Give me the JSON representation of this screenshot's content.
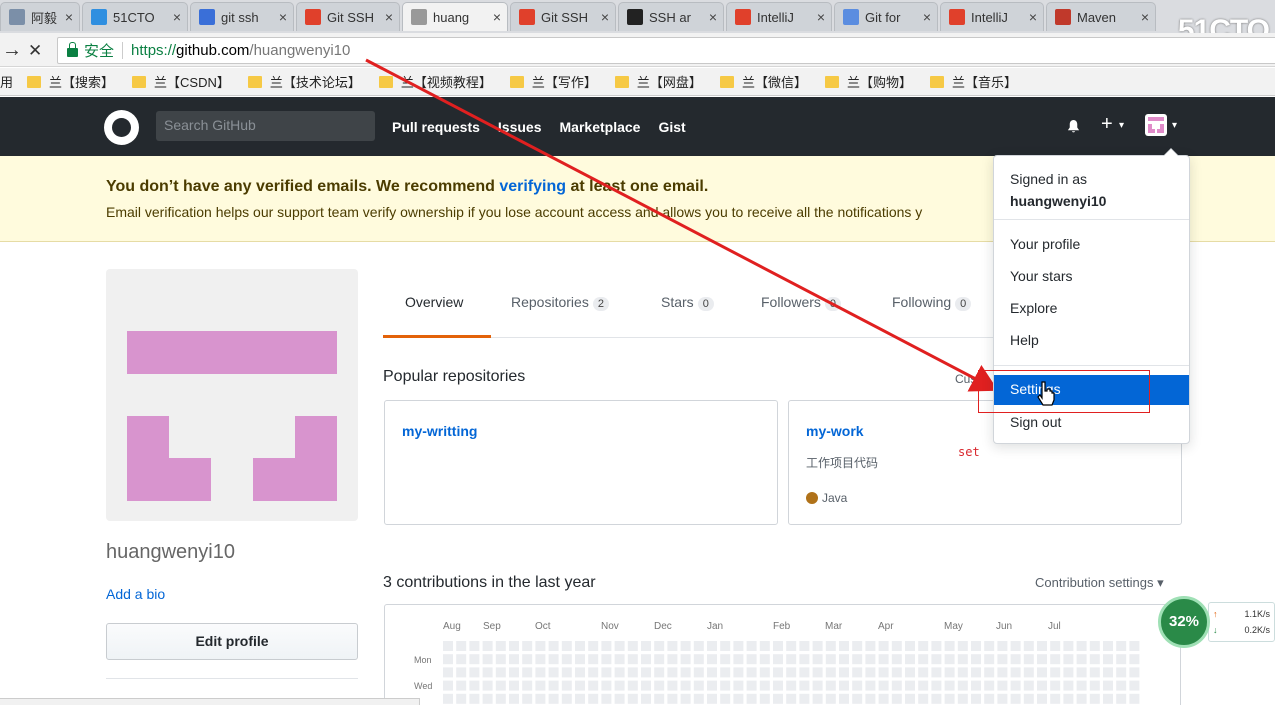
{
  "browser": {
    "tabs": [
      {
        "label": "阿毅 - ",
        "color": "#7b8fa8"
      },
      {
        "label": "51CTO",
        "color": "#2f8fe0"
      },
      {
        "label": "git ssh",
        "color": "#3a6fd8"
      },
      {
        "label": "Git SSH",
        "color": "#e0402b"
      },
      {
        "label": "huang",
        "color": "#999999"
      },
      {
        "label": "Git SSH",
        "color": "#e0402b"
      },
      {
        "label": "SSH ar",
        "color": "#222222"
      },
      {
        "label": "IntelliJ",
        "color": "#e0402b"
      },
      {
        "label": "Git for",
        "color": "#5b8de0"
      },
      {
        "label": "IntelliJ",
        "color": "#e0402b"
      },
      {
        "label": "Maven",
        "color": "#c0392b"
      }
    ],
    "close_glyph": "×",
    "watermark": "51CTO",
    "back_glyph": "→",
    "stop_glyph": "✕",
    "secure_label": "安全",
    "url": {
      "protocol": "https://",
      "host": "github.com",
      "path": "/huangwenyi10"
    },
    "bookmarks_prefix": "用",
    "bookmarks": [
      "兰【搜索】",
      "兰【CSDN】",
      "兰【技术论坛】",
      "兰【视频教程】",
      "兰【写作】",
      "兰【网盘】",
      "兰【微信】",
      "兰【购物】",
      "兰【音乐】"
    ]
  },
  "header": {
    "search_placeholder": "Search GitHub",
    "nav": [
      "Pull requests",
      "Issues",
      "Marketplace",
      "Gist"
    ],
    "plus_glyph": "+",
    "caret_glyph": "▾"
  },
  "flash": {
    "line1_a": "You don’t have any verified emails. We recommend ",
    "line1_link": "verifying",
    "line1_b": " at least one email.",
    "line2": "Email verification helps our support team verify ownership if you lose account access and allows you to receive all the notifications y"
  },
  "profile": {
    "username": "huangwenyi10",
    "add_bio": "Add a bio",
    "edit_profile": "Edit profile"
  },
  "tabs": [
    {
      "label": "Overview",
      "count": ""
    },
    {
      "label": "Repositories",
      "count": "2"
    },
    {
      "label": "Stars",
      "count": "0"
    },
    {
      "label": "Followers",
      "count": "0"
    },
    {
      "label": "Following",
      "count": "0"
    }
  ],
  "popular": {
    "title": "Popular repositories",
    "customize": "Custo",
    "repos": [
      {
        "name": "my-writting",
        "description": "",
        "language": ""
      },
      {
        "name": "my-work",
        "description": "工作项目代码",
        "language": "Java",
        "language_color": "#b07219"
      }
    ]
  },
  "annotation_text": "set",
  "contributions": {
    "title": "3 contributions in the last year",
    "settings": "Contribution settings ▾",
    "months": [
      "Aug",
      "Sep",
      "Oct",
      "Nov",
      "Dec",
      "Jan",
      "Feb",
      "Mar",
      "Apr",
      "May",
      "Jun",
      "Jul"
    ],
    "day_labels": [
      "Mon",
      "Wed"
    ]
  },
  "menu": {
    "signed_in_as": "Signed in as",
    "user": "huangwenyi10",
    "items": [
      "Your profile",
      "Your stars",
      "Explore",
      "Help"
    ],
    "settings": "Settings",
    "sign_out": "Sign out"
  },
  "netmon": {
    "percent": "32%",
    "up": "1.1K/s",
    "down": "0.2K/s"
  },
  "colors": {
    "accent": "#0366d6",
    "header": "#24292e",
    "tab_underline": "#e36209",
    "annotation": "#e02020",
    "avatar": "#d894ce"
  }
}
